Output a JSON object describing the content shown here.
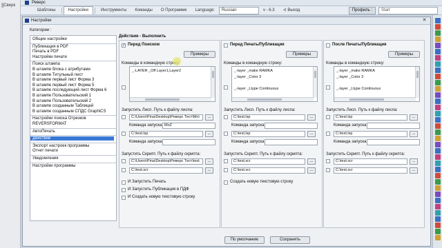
{
  "underlying": {
    "crumb": "][Сверк"
  },
  "app": {
    "title": "Реверс",
    "menu": [
      "Шаблоны",
      "Настройки",
      "Инструменты",
      "Команды",
      "О Программе"
    ],
    "active_menu": 1,
    "language_label": "Language:",
    "language_value": "Russian",
    "version": "v - 6.3",
    "exit": "Выход",
    "profile": "Профиль :",
    "start": "Start"
  },
  "dialog": {
    "title": "Настройки",
    "close": "✕",
    "categories_label": "Категории :",
    "categories": [
      {
        "label": "Общие настройки"
      },
      {
        "label": "Публикация в PDF"
      },
      {
        "label": "Печать в PDF"
      },
      {
        "label": "Настройки печати"
      },
      {
        "label": "Поиск штампа"
      },
      {
        "label": "В штампе блока с атрибутами"
      },
      {
        "label": "В штампе Титульный лист"
      },
      {
        "label": "В штампе первый лист Форма 3"
      },
      {
        "label": "В штампе первый лист Форма 5"
      },
      {
        "label": "В штампе последующий лист Форма 6"
      },
      {
        "label": "В штампе Пользовательский 1"
      },
      {
        "label": "В штампе Пользовательский 2"
      },
      {
        "label": "В штампе созданным Таблицей"
      },
      {
        "label": "В штампе созданным СПДС GraphiCS"
      },
      {
        "label": "Настройки поиска Отрезков"
      },
      {
        "label": "REVERSFORMAT"
      },
      {
        "label": "АвтоПечать"
      },
      {
        "label": "Действие"
      },
      {
        "label": "Экспорт настроек программы"
      },
      {
        "label": "Отчет печати"
      },
      {
        "label": "Уведомления"
      },
      {
        "label": "Настройки программы"
      }
    ],
    "selected_category": 17,
    "panel_title": "Действия - Выполнить",
    "columns": [
      {
        "title": "Перед Поиском",
        "checked": true,
        "examples": "Примеры",
        "cmd_label": "Команды в командную строку:",
        "cmd_lines": [
          "_-LAYER _Off Layer1,Layer2"
        ],
        "lisp_label": "Запустить Лисп. Путь к файлу лиспа:",
        "lisp_path": "C:\\Users\\Pina\\Desktop\\Реверс Тест\\Mo\\",
        "lisp_cmd_label": "Команда запуска:",
        "lisp_cmd": "MoZ",
        "lisp2_path": "C:\\test.lsp",
        "lisp2_cmd": "",
        "script_label": "Запустить Скрипт. Путь к файлу скрипта:",
        "script_path": "C:\\Users\\Pina\\Desktop\\Реверс Тест\\test.",
        "script2_path": "C:\\test.scr"
      },
      {
        "title": "Перед Печать/Публикация",
        "checked": false,
        "examples": "Примеры",
        "cmd_label": "Команды в командную строку:",
        "cmd_lines": [
          "_-layer _make RAMKA",
          "_-layer _Color 3",
          "",
          "_-layer _Ltype Continuous"
        ],
        "lisp_label": "Запустить Лисп. Путь к файлу лиспа:",
        "lisp_path": "C:\\test.lsp",
        "lisp_cmd_label": "Команда запуска:",
        "lisp_cmd": "",
        "lisp2_path": "C:\\test.lsp",
        "lisp2_cmd": "",
        "script_label": "Запустить Скрипт. Путь к файлу скрипта:",
        "script_path": "C:\\test.scr",
        "script2_path": "C:\\test.scr"
      },
      {
        "title": "После Печать/Публикация",
        "checked": false,
        "examples": "Примеры",
        "cmd_label": "Команды в командную строку:",
        "cmd_lines": [
          "_-layer _make RAMKA",
          "_-layer _Color 3",
          "",
          "_-layer _Ltype Continuous"
        ],
        "lisp_label": "Запустить Лисп. Путь к файлу лиспа:",
        "lisp_path": "C:\\test.lsp",
        "lisp_cmd_label": "Команда запуска:",
        "lisp_cmd": "",
        "lisp2_path": "C:\\test.lsp",
        "lisp2_cmd": "",
        "script_label": "Запустить Скрипт. Путь к файлу скрипта:",
        "script_path": "C:\\test.scr",
        "script2_path": "C:\\test.scr"
      }
    ],
    "col1_extra": [
      "И Запустить Печать",
      "И Запустить Публикация в ПДФ",
      "И Создать новую текстовую строку"
    ],
    "col2_extra": [
      "Создать новую текстовую строку"
    ],
    "cmd_label_short": "Команда запуска:",
    "dots": "...",
    "default_button": "По умолчанию",
    "save_button": "Сохранить"
  },
  "colors": {
    "accent": "#3a78d6",
    "title_blue": "#1a3e8c"
  }
}
